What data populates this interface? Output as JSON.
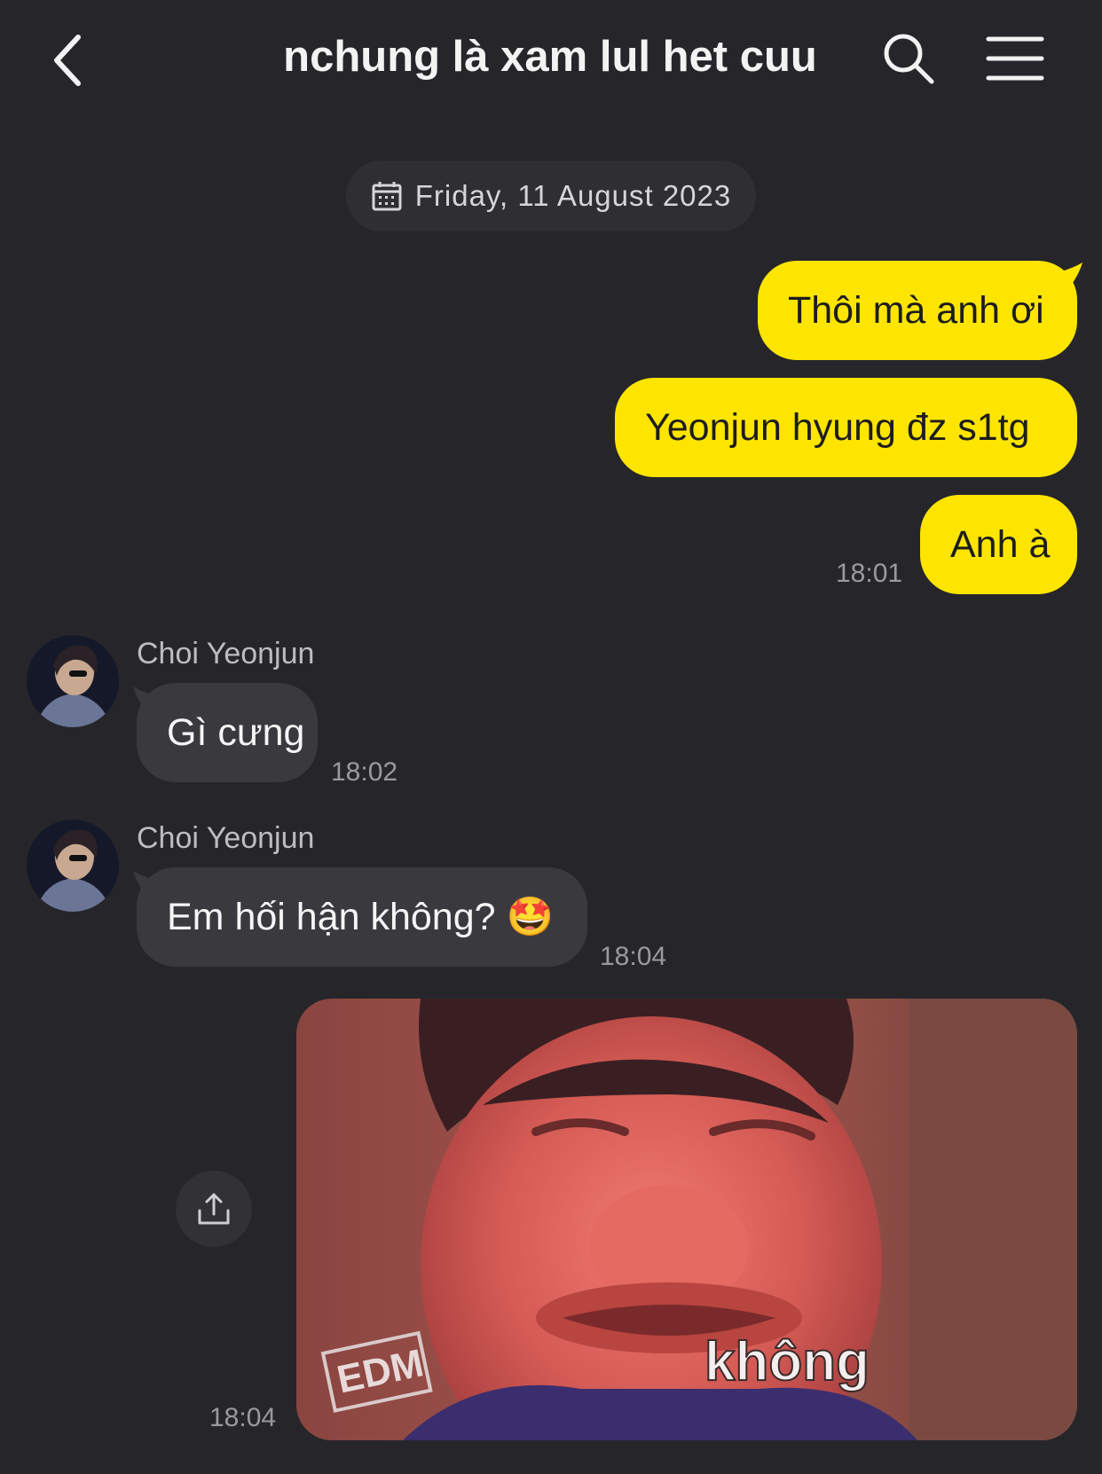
{
  "header": {
    "title": "nchung là xam lul het cuu",
    "back_icon": "chevron-left-icon",
    "search_icon": "search-icon",
    "menu_icon": "hamburger-menu-icon"
  },
  "date_divider": {
    "icon": "calendar-icon",
    "text": "Friday, 11 August 2023"
  },
  "messages": [
    {
      "from": "me",
      "text": "Thôi mà anh ơi"
    },
    {
      "from": "me",
      "text": "Yeonjun hyung đz s1tg"
    },
    {
      "from": "me",
      "text": "Anh à",
      "time": "18:01"
    },
    {
      "from": "Choi Yeonjun",
      "sender": "Choi Yeonjun",
      "text": "Gì cưng",
      "time": "18:02"
    },
    {
      "from": "Choi Yeonjun",
      "sender": "Choi Yeonjun",
      "text": "Em hối hận không? 🤩",
      "time": "18:04"
    },
    {
      "from": "me",
      "type": "image",
      "image_caption": "không",
      "image_watermark": "EDM",
      "time": "18:04"
    }
  ],
  "colors": {
    "background": "#26262a",
    "my_bubble": "#fee500",
    "their_bubble": "#3a3a3e"
  }
}
